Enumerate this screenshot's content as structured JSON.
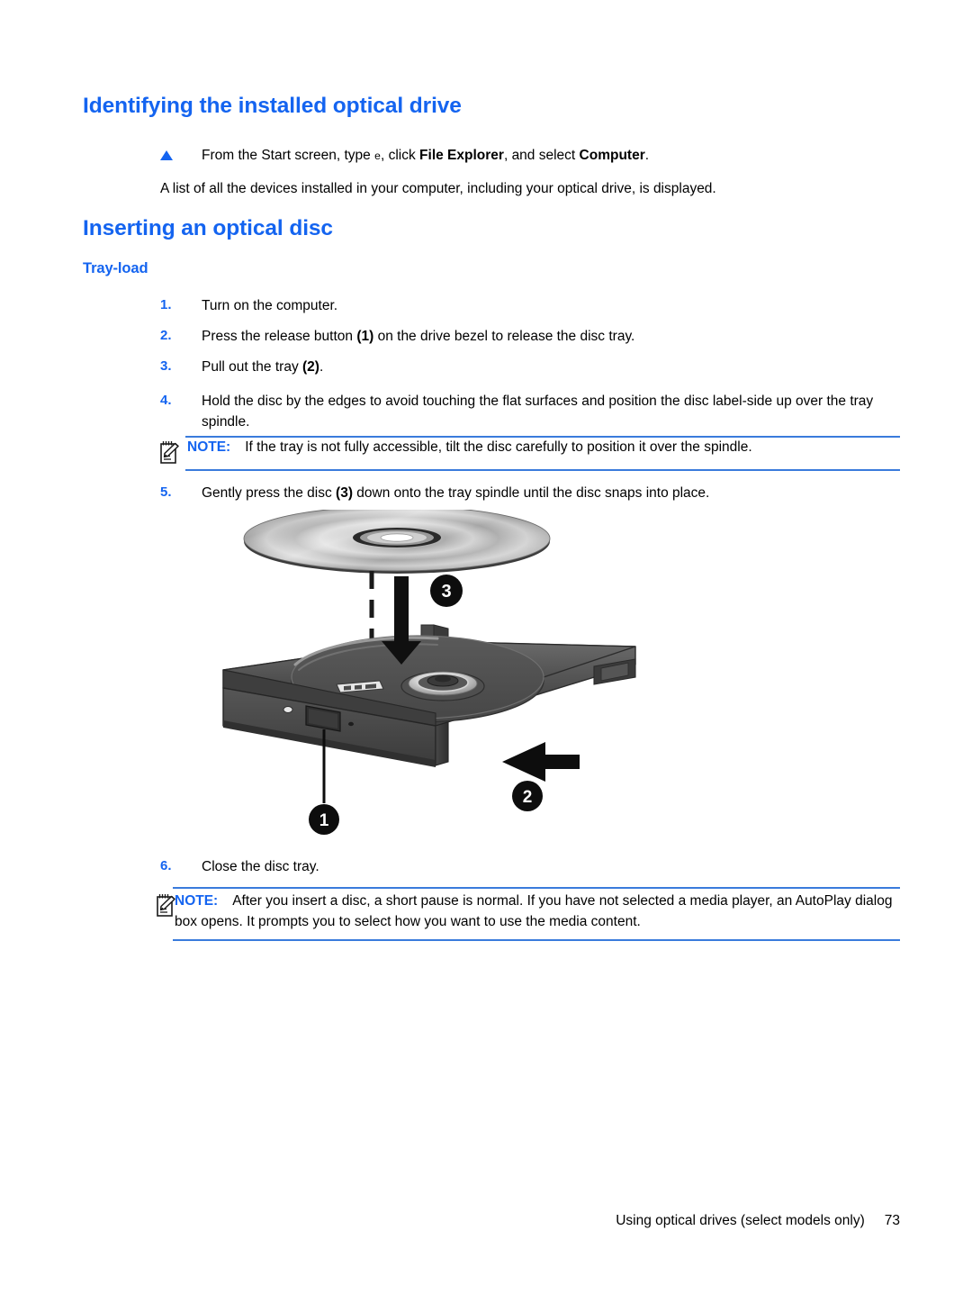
{
  "document": {
    "headings": {
      "h1_identifying": "Identifying the installed optical drive",
      "h1_inserting": "Inserting an optical disc",
      "h2_tray_load": "Tray-load"
    },
    "bullet": {
      "text_before": "From the Start screen, type ",
      "key": "e",
      "text_mid": ", click ",
      "bold_1": "File Explorer",
      "text_mid_2": ", and select ",
      "bold_2": "Computer",
      "text_end": "."
    },
    "paragraph_list": "A list of all the devices installed in your computer, including your optical drive, is displayed.",
    "steps": [
      {
        "num": "1.",
        "text": "Turn on the computer."
      },
      {
        "num": "2.",
        "pre": "Press the release button ",
        "ref": "(1)",
        "post": " on the drive bezel to release the disc tray."
      },
      {
        "num": "3.",
        "pre": "Pull out the tray ",
        "ref": "(2)",
        "post": "."
      },
      {
        "num": "4.",
        "text": "Hold the disc by the edges to avoid touching the flat surfaces and position the disc label-side up over the tray spindle."
      },
      {
        "num": "5.",
        "pre": "Gently press the disc ",
        "ref": "(3)",
        "post": " down onto the tray spindle until the disc snaps into place."
      },
      {
        "num": "6.",
        "text": "Close the disc tray."
      }
    ],
    "notes": [
      {
        "label": "NOTE:",
        "icon": "note-pad-pencil-icon",
        "text": "If the tray is not fully accessible, tilt the disc carefully to position it over the spindle."
      },
      {
        "label": "NOTE:",
        "icon": "note-pad-pencil-icon",
        "text": "After you insert a disc, a short pause is normal. If you have not selected a media player, an AutoPlay dialog box opens. It prompts you to select how you want to use the media content."
      }
    ],
    "figure": {
      "name": "optical-drive-tray-illustration",
      "callouts": [
        {
          "id": "1",
          "meaning": "release button"
        },
        {
          "id": "2",
          "meaning": "pull out the tray"
        },
        {
          "id": "3",
          "meaning": "press disc onto spindle"
        }
      ]
    },
    "footer": {
      "section": "Using optical drives (select models only)",
      "page_number": "73"
    },
    "colors": {
      "heading_blue": "#1464f0",
      "rule_blue": "#3a7bdc",
      "text_black": "#000000",
      "page_background": "#ffffff"
    }
  }
}
